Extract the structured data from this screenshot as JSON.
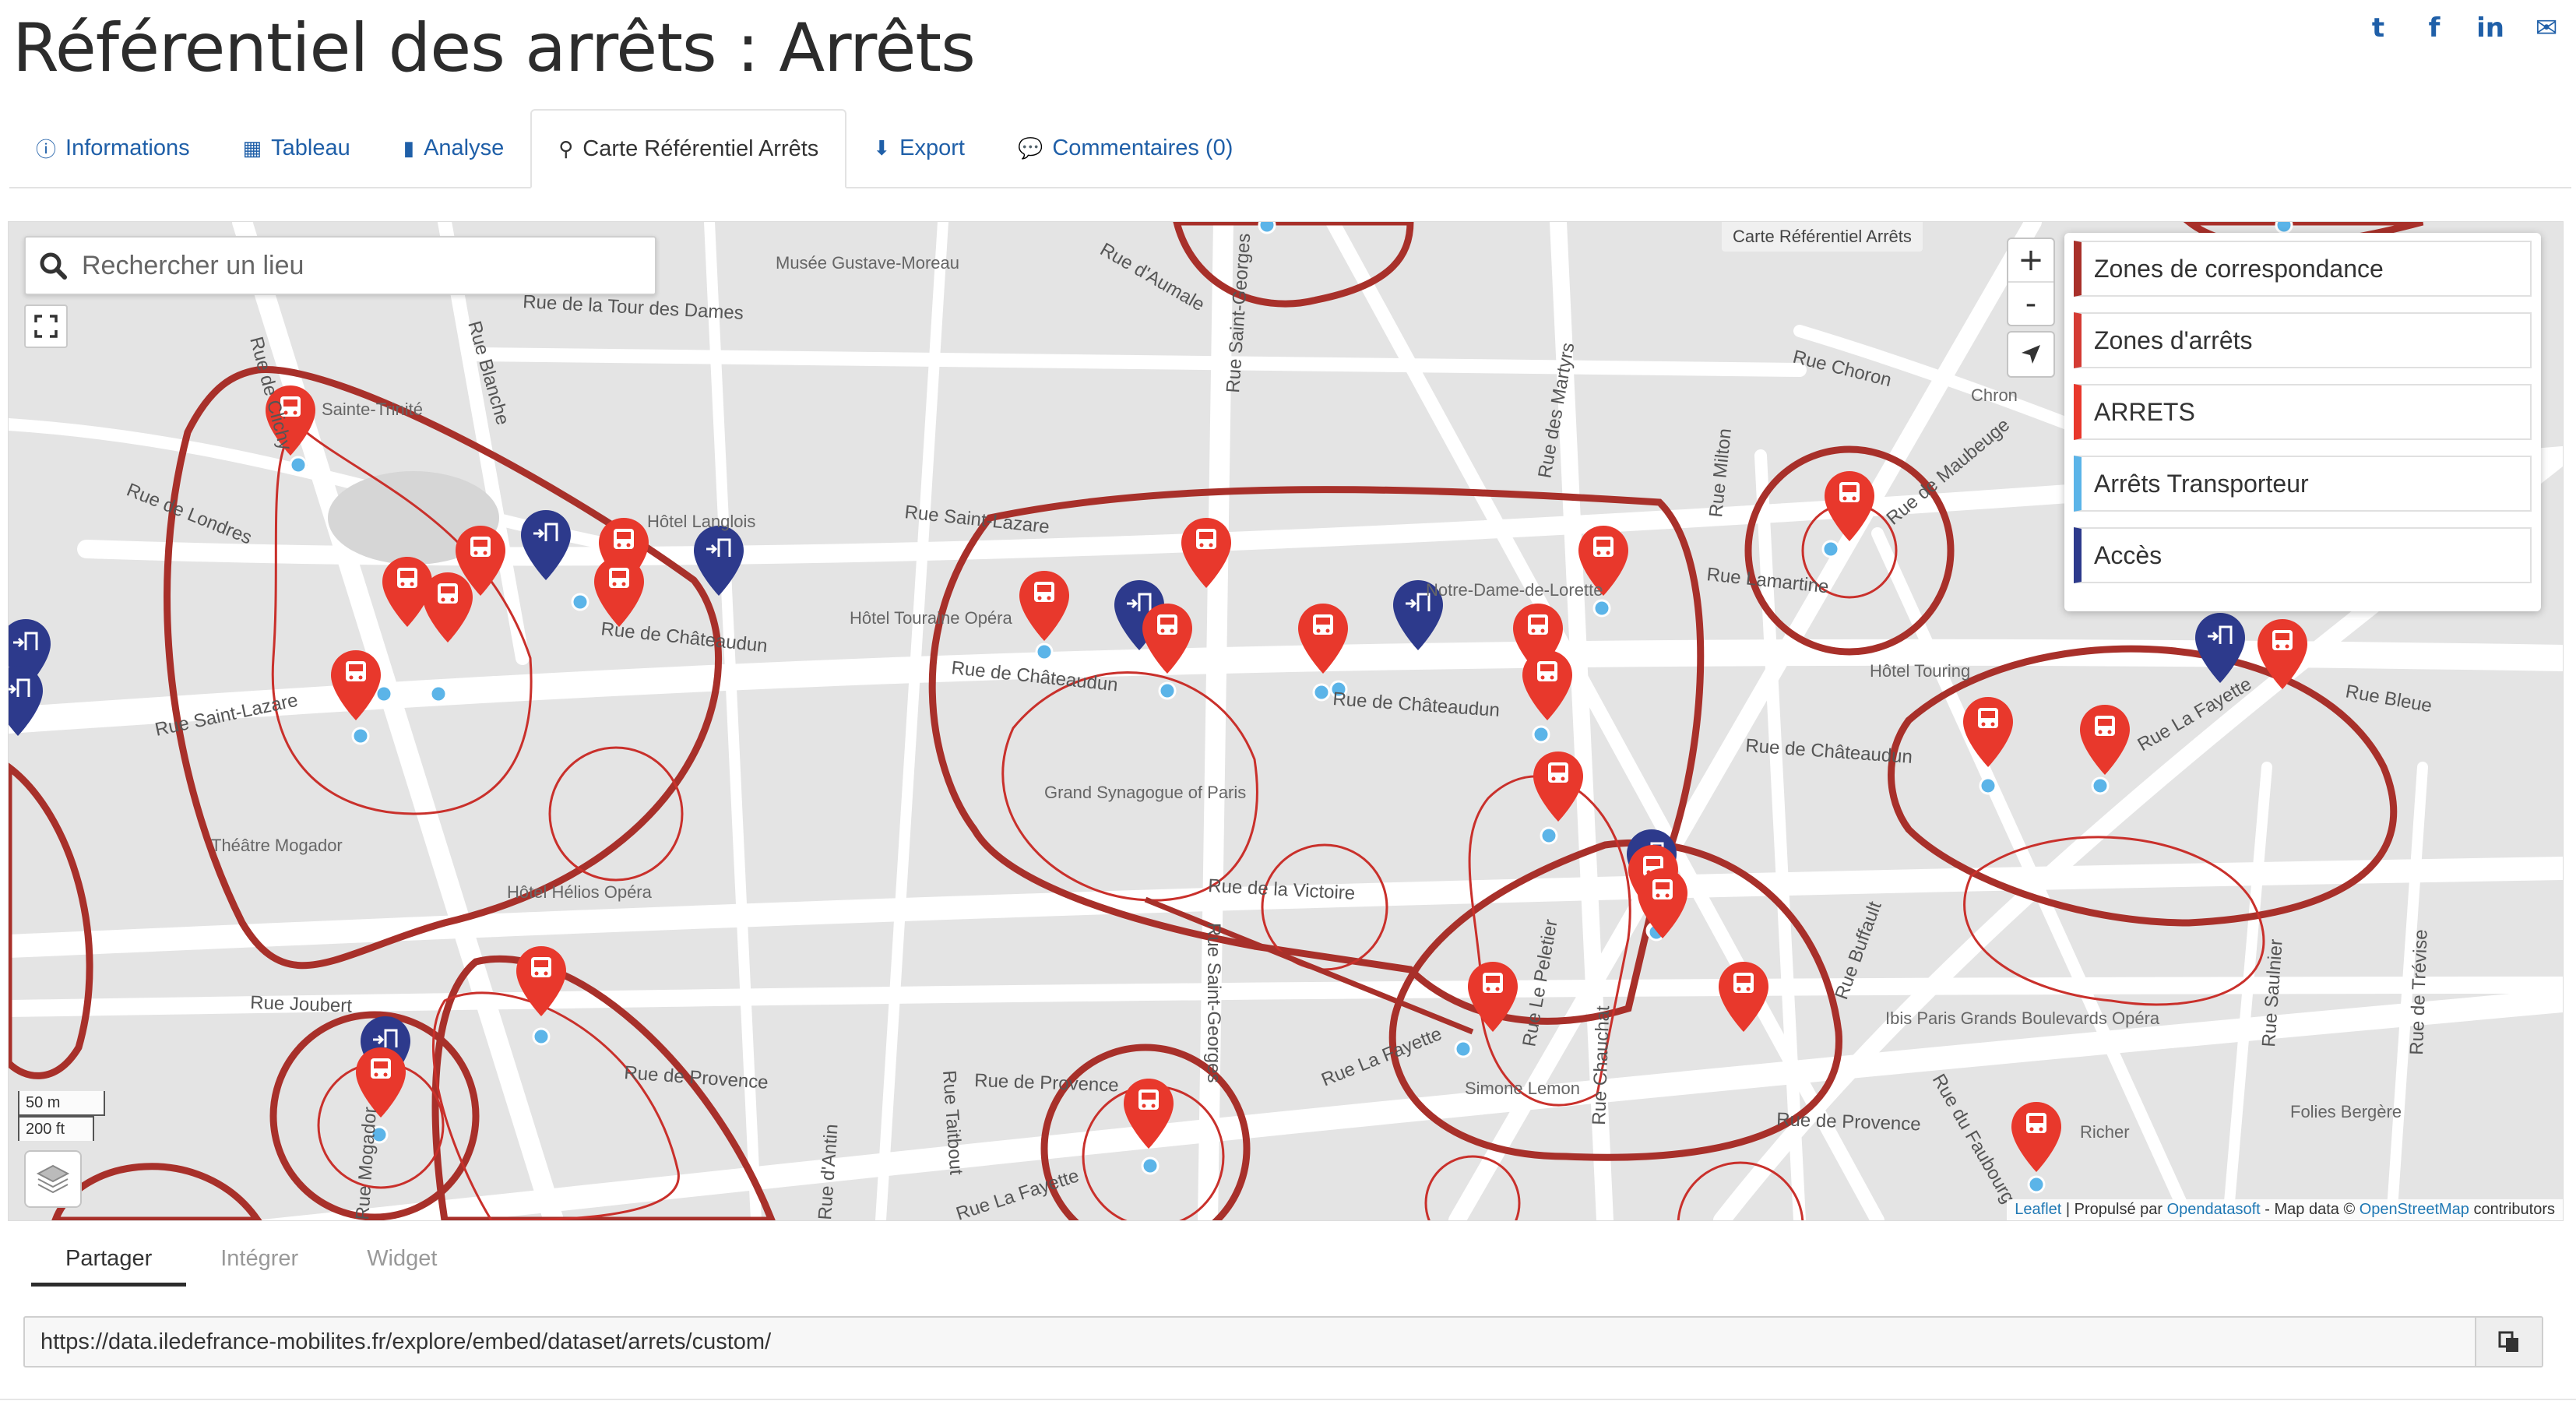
{
  "page": {
    "title": "Référentiel des arrêts : Arrêts"
  },
  "social": [
    {
      "name": "twitter-icon",
      "glyph": "t"
    },
    {
      "name": "facebook-icon",
      "glyph": "f"
    },
    {
      "name": "linkedin-icon",
      "glyph": "in"
    },
    {
      "name": "mail-icon",
      "glyph": "✉"
    }
  ],
  "tabs": [
    {
      "label": "Informations",
      "icon": "info-circle-icon",
      "glyph": "ⓘ",
      "active": false
    },
    {
      "label": "Tableau",
      "icon": "table-icon",
      "glyph": "▦",
      "active": false
    },
    {
      "label": "Analyse",
      "icon": "bar-chart-icon",
      "glyph": "▮",
      "active": false
    },
    {
      "label": "Carte Référentiel Arrêts",
      "icon": "map-marker-icon",
      "glyph": "⚲",
      "active": true
    },
    {
      "label": "Export",
      "icon": "download-icon",
      "glyph": "⬇",
      "active": false
    },
    {
      "label": "Commentaires (0)",
      "icon": "comments-icon",
      "glyph": "💬",
      "active": false
    }
  ],
  "map": {
    "search_placeholder": "Rechercher un lieu",
    "map_title": "Carte Référentiel Arrêts",
    "zoom_in": "+",
    "zoom_out": "-",
    "scale_metric": "50 m",
    "scale_imperial": "200 ft",
    "attribution": {
      "leaflet": "Leaflet",
      "sep1": " | Propulsé par ",
      "ods": "Opendatasoft",
      "sep2": " - Map data © ",
      "osm": "OpenStreetMap",
      "contrib": " contributors"
    },
    "legend": [
      {
        "label": "Zones de correspondance",
        "color": "#a8302a"
      },
      {
        "label": "Zones d'arrêts",
        "color": "#d43b34"
      },
      {
        "label": "ARRETS",
        "color": "#e8382c"
      },
      {
        "label": "Arrêts Transporteur",
        "color": "#5bb4e8"
      },
      {
        "label": "Accès",
        "color": "#2d3a8c"
      }
    ],
    "street_labels": [
      "Rue Saint-Lazare",
      "Rue Saint-Lazare",
      "Rue de Châteaudun",
      "Rue de Châteaudun",
      "Rue de Châteaudun",
      "Rue de Châteaudun",
      "Rue de Londres",
      "Rue de la Tour des Dames",
      "Rue Blanche",
      "Rue d'Aumale",
      "Rue Saint-Georges",
      "Rue des Martyrs",
      "Rue Choron",
      "Rue Milton",
      "Rue Lamartine",
      "Rue de Maubeuge",
      "Rue de la Victoire",
      "Rue Joubert",
      "Rue de Provence",
      "Rue de Provence",
      "Rue de Provence",
      "Rue La Fayette",
      "Rue La Fayette",
      "Rue La Fayette",
      "Rue Taitbout",
      "Rue Chauchat",
      "Rue Le Peletier",
      "Rue Buffault",
      "Rue Saulnier",
      "Rue de Trévise",
      "Rue Bleue",
      "Rue Saint-Georges",
      "Rue Mogador",
      "Rue de Clichy",
      "Rue d'Antin",
      "Rue du Faubourg"
    ],
    "place_labels": [
      "Musée Gustave-Moreau",
      "Sainte-Trinité",
      "Hôtel Langlois",
      "Hôtel Touraine Opéra",
      "Grand Synagogue of Paris",
      "Théâtre Mogador",
      "Hôtel Hélios Opéra",
      "Notre-Dame-de-Lorette",
      "Hôtel Touring",
      "Chron",
      "Ibis Paris Grands Boulevards Opéra",
      "Folies Bergère",
      "Simone Lemon",
      "Richer"
    ]
  },
  "share": {
    "tabs": [
      "Partager",
      "Intégrer",
      "Widget"
    ],
    "url": "https://data.iledefrance-mobilites.fr/explore/embed/dataset/arrets/custom/"
  }
}
